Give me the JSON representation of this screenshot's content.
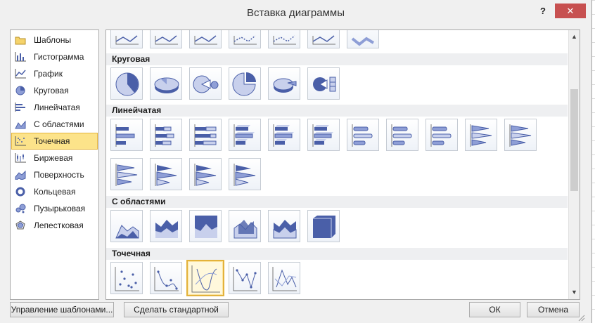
{
  "dialog": {
    "title": "Вставка диаграммы",
    "help_label": "?",
    "close_label": "✕"
  },
  "categories": [
    {
      "label": "Шаблоны",
      "icon": "folder-icon"
    },
    {
      "label": "Гистограмма",
      "icon": "column-chart-icon"
    },
    {
      "label": "График",
      "icon": "line-chart-icon"
    },
    {
      "label": "Круговая",
      "icon": "pie-chart-icon"
    },
    {
      "label": "Линейчатая",
      "icon": "bar-chart-icon"
    },
    {
      "label": "С областями",
      "icon": "area-chart-icon"
    },
    {
      "label": "Точечная",
      "icon": "scatter-chart-icon",
      "selected": true
    },
    {
      "label": "Биржевая",
      "icon": "stock-chart-icon"
    },
    {
      "label": "Поверхность",
      "icon": "surface-chart-icon"
    },
    {
      "label": "Кольцевая",
      "icon": "doughnut-chart-icon"
    },
    {
      "label": "Пузырьковая",
      "icon": "bubble-chart-icon"
    },
    {
      "label": "Лепестковая",
      "icon": "radar-chart-icon"
    }
  ],
  "sections": {
    "pie": "Круговая",
    "bar": "Линейчатая",
    "area": "С областями",
    "scatter": "Точечная"
  },
  "buttons": {
    "manage_templates": "Управление шаблонами...",
    "set_default": "Сделать стандартной",
    "ok": "ОК",
    "cancel": "Отмена"
  },
  "colors": {
    "accent": "#4a5fa8",
    "selection": "#fce38a",
    "selection_border": "#e3b23b",
    "close": "#c75050"
  }
}
